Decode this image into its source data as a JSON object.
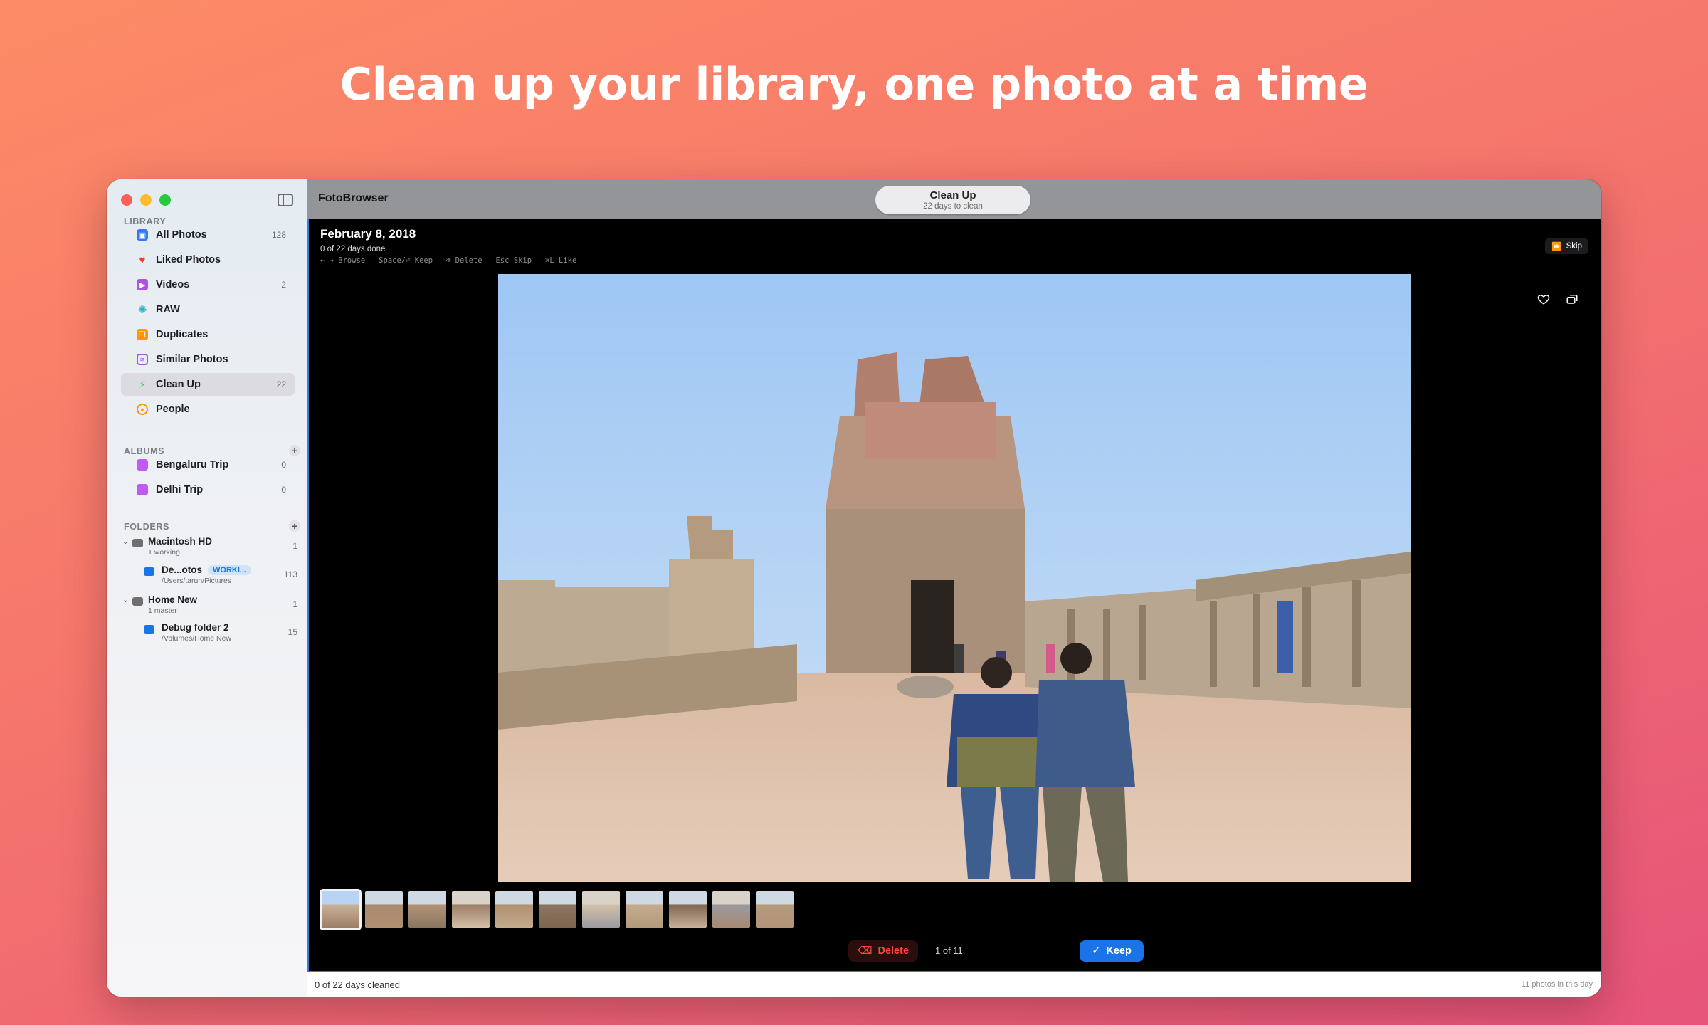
{
  "headline": "Clean up your library, one photo at a time",
  "sidebar": {
    "library_header": "LIBRARY",
    "library_items": [
      {
        "label": "All Photos",
        "count": "128",
        "icon": "photos-stack-icon",
        "color": "#3478f6"
      },
      {
        "label": "Liked Photos",
        "count": "",
        "icon": "heart-icon",
        "color": "#ff3b30"
      },
      {
        "label": "Videos",
        "count": "2",
        "icon": "video-icon",
        "color": "#af52de"
      },
      {
        "label": "RAW",
        "count": "",
        "icon": "raw-aperture-icon",
        "color": "#30b0c7"
      },
      {
        "label": "Duplicates",
        "count": "",
        "icon": "duplicates-icon",
        "color": "#ff9500"
      },
      {
        "label": "Similar Photos",
        "count": "",
        "icon": "similar-photos-icon",
        "color": "#af52de"
      },
      {
        "label": "Clean Up",
        "count": "22",
        "icon": "magic-wand-icon",
        "color": "#34c759",
        "active": true
      },
      {
        "label": "People",
        "count": "",
        "icon": "person-icon",
        "color": "#ff9500"
      }
    ],
    "albums_header": "ALBUMS",
    "albums": [
      {
        "label": "Bengaluru Trip",
        "count": "0"
      },
      {
        "label": "Delhi Trip",
        "count": "0"
      }
    ],
    "folders_header": "FOLDERS",
    "folders": [
      {
        "title": "Macintosh HD",
        "sub": "1 working",
        "count": "1",
        "type": "drive"
      },
      {
        "title": "De...otos",
        "badge": "WORKI...",
        "sub": "/Users/tarun/Pictures",
        "count": "113",
        "type": "library"
      },
      {
        "title": "Home New",
        "sub": "1 master",
        "count": "1",
        "type": "drive"
      },
      {
        "title": "Debug folder 2",
        "sub": "/Volumes/Home New",
        "count": "15",
        "type": "folder"
      }
    ]
  },
  "titlebar": {
    "app_name": "FotoBrowser",
    "pill_title": "Clean Up",
    "pill_subtitle": "22 days to clean"
  },
  "viewer": {
    "date": "February 8, 2018",
    "progress": "0 of 22 days done",
    "shortcuts": "← → Browse   Space/⏎ Keep   ⌫ Delete   Esc Skip   ⌘L Like",
    "skip_label": "Skip",
    "delete_label": "Delete",
    "counter": "1 of 11",
    "keep_label": "Keep",
    "thumbnail_count": 11,
    "selected_thumbnail": 1
  },
  "statusbar": {
    "left": "0 of 22 days cleaned",
    "right": "11 photos in this day"
  },
  "colors": {
    "accent": "#1a73e8",
    "delete": "#ff453a",
    "selection_border": "#3a7bd5"
  }
}
